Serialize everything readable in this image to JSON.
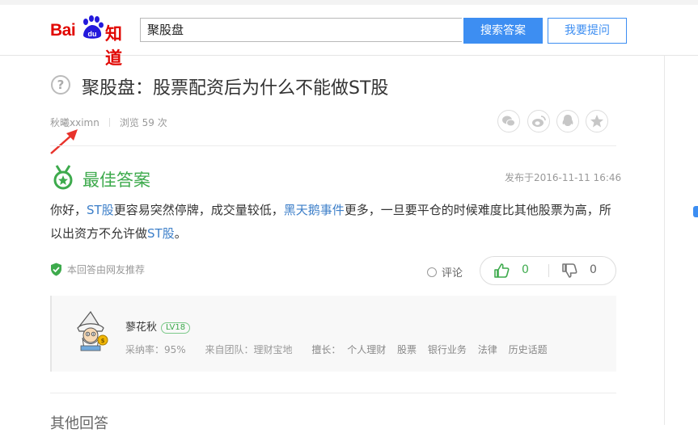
{
  "bookmarks": [
    "",
    "",
    "",
    "",
    "",
    "",
    "",
    "",
    "",
    "",
    "",
    "",
    ""
  ],
  "header": {
    "logo_text_red": "Bai",
    "logo_text_blue": "du",
    "logo_text_zhidao": "知道",
    "search_value": "聚股盘",
    "search_button": "搜索答案",
    "ask_button": "我要提问"
  },
  "question": {
    "title": "聚股盘：股票配资后为什么不能做ST股",
    "asker": "秋曦xximn",
    "views": "浏览 59 次"
  },
  "share_icons": [
    "wechat-icon",
    "weibo-icon",
    "qq-icon",
    "qzone-icon"
  ],
  "best_answer": {
    "label": "最佳答案",
    "published": "发布于2016-11-11 16:46",
    "text_1": "你好，",
    "link_1": "ST股",
    "text_2": "更容易突然停牌，成交量较低，",
    "link_2": "黑天鹅事件",
    "text_3": "更多，一旦要平仓的时候难度比其他股票为高，所以出资方不允许做",
    "link_3": "ST股",
    "text_4": "。",
    "recommend": "本回答由网友推荐",
    "comment": "评论",
    "up_count": "0",
    "down_count": "0"
  },
  "answerer": {
    "name": "蓼花秋",
    "level": "LV18",
    "adopt_rate": "采纳率：95%",
    "team": "来自团队：理财宝地",
    "expertise_label": "擅长：",
    "tags": [
      "个人理财",
      "股票",
      "银行业务",
      "法律",
      "历史话题"
    ]
  },
  "other_answers": "其他回答",
  "colors": {
    "brand_red": "#e10601",
    "brand_blue": "#2319dc",
    "accent_blue": "#3d8ef2",
    "best_green": "#3daa4c"
  }
}
